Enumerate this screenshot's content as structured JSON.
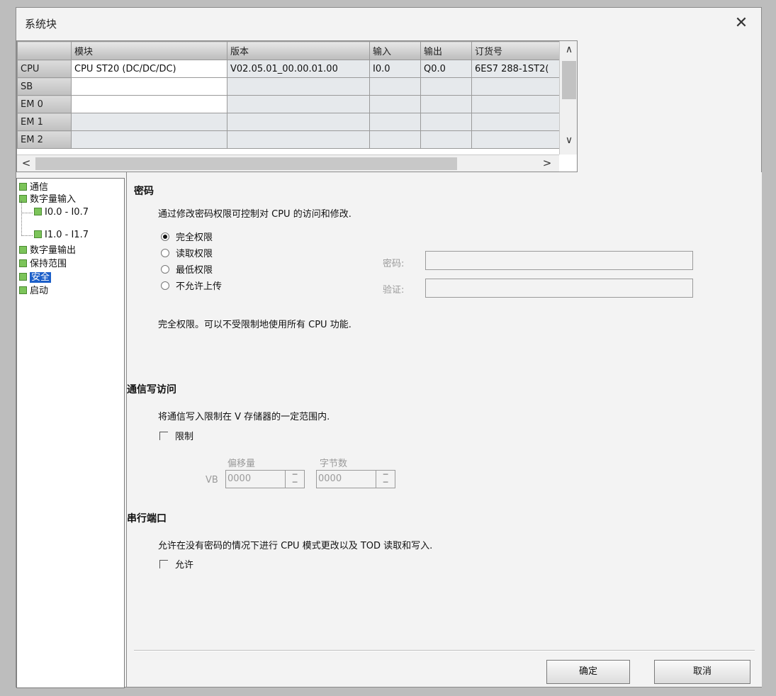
{
  "window": {
    "title": "系统块",
    "close_glyph": "✕"
  },
  "grid": {
    "headers": [
      "",
      "模块",
      "版本",
      "输入",
      "输出",
      "订货号"
    ],
    "rows": [
      {
        "slot": "CPU",
        "module": "CPU ST20 (DC/DC/DC)",
        "version": "V02.05.01_00.00.01.00",
        "input": "I0.0",
        "output": "Q0.0",
        "order": "6ES7 288-1ST2("
      },
      {
        "slot": "SB",
        "module": "",
        "version": "",
        "input": "",
        "output": "",
        "order": ""
      },
      {
        "slot": "EM 0",
        "module": "",
        "version": "",
        "input": "",
        "output": "",
        "order": ""
      },
      {
        "slot": "EM 1",
        "module": "",
        "version": "",
        "input": "",
        "output": "",
        "order": ""
      },
      {
        "slot": "EM 2",
        "module": "",
        "version": "",
        "input": "",
        "output": "",
        "order": ""
      }
    ],
    "scroll": {
      "up": "∧",
      "down": "∨",
      "left": "<",
      "right": ">"
    }
  },
  "tree": {
    "items": [
      {
        "label": "通信"
      },
      {
        "label": "数字量输入"
      },
      {
        "label": "I0.0 - I0.7"
      },
      {
        "label": "I1.0 - I1.7"
      },
      {
        "label": "数字量输出"
      },
      {
        "label": "保持范围"
      },
      {
        "label": "安全"
      },
      {
        "label": "启动"
      }
    ]
  },
  "password": {
    "title": "密码",
    "description": "通过修改密码权限可控制对 CPU 的访问和修改.",
    "options": [
      "完全权限",
      "读取权限",
      "最低权限",
      "不允许上传"
    ],
    "selected_index": 0,
    "password_label": "密码:",
    "verify_label": "验证:",
    "password_value": "",
    "verify_value": "",
    "note": "完全权限。可以不受限制地使用所有 CPU 功能."
  },
  "comm_write": {
    "title": "通信写访问",
    "description": "将通信写入限制在 V 存储器的一定范围内.",
    "limit_label": "限制",
    "offset_label": "偏移量",
    "bytes_label": "字节数",
    "vb_label": "VB",
    "offset_value": "0000",
    "bytes_value": "0000"
  },
  "serial": {
    "title": "串行端口",
    "description": "允许在没有密码的情况下进行 CPU 模式更改以及 TOD 读取和写入.",
    "allow_label": "允许"
  },
  "buttons": {
    "ok": "确定",
    "cancel": "取消"
  }
}
